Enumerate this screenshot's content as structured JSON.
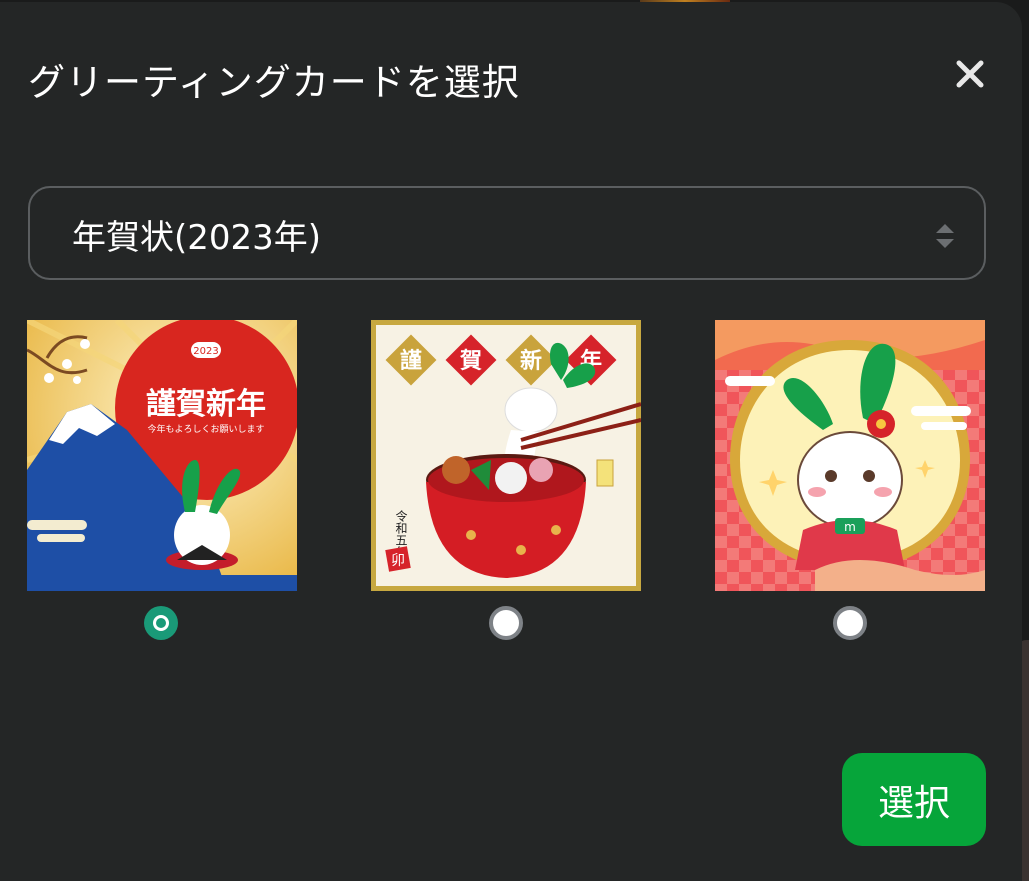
{
  "dialog": {
    "title": "グリーティングカードを選択",
    "close_icon": "close-icon",
    "category": {
      "selected": "年賀状(2023年)",
      "arrows_icon": "sort-arrows-icon"
    },
    "cards": [
      {
        "name": "card-mt-fuji-sunrise",
        "heading": "謹賀新年",
        "subheading": "今年もよろしくお願いします",
        "badge": "2023",
        "selected": true
      },
      {
        "name": "card-ozoni-bowl",
        "diamonds": [
          "謹",
          "賀",
          "新",
          "年"
        ],
        "vertical_text": "令和五年",
        "stamp": "卯",
        "selected": false
      },
      {
        "name": "card-kimono-rabbit",
        "badge": "m",
        "selected": false
      }
    ],
    "submit_label": "選択"
  },
  "colors": {
    "accent_green": "#06a53a",
    "radio_selected": "#1a9a78",
    "dialog_bg": "#242626"
  }
}
